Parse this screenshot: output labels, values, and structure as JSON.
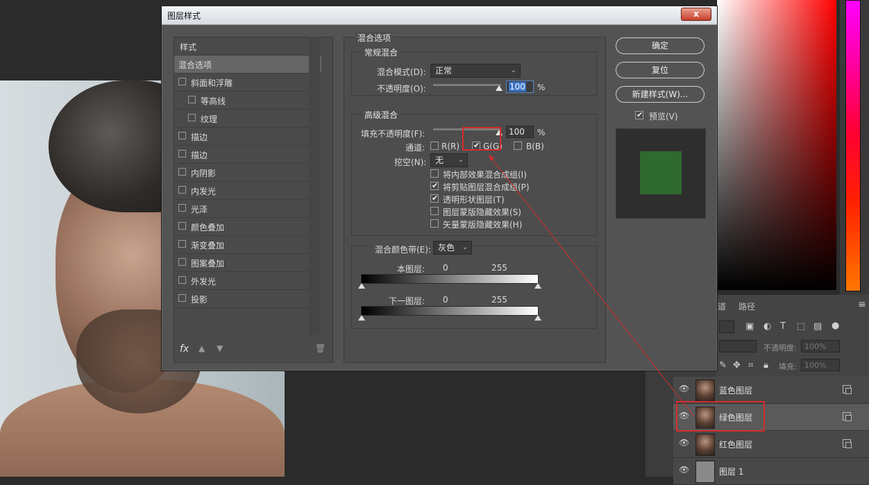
{
  "dialog": {
    "title": "图层样式",
    "close_label": "x",
    "styles_list": {
      "header": "样式",
      "items": [
        {
          "label": "混合选项",
          "checkbox": false,
          "active": true,
          "plus": false,
          "indent": false
        },
        {
          "label": "斜面和浮雕",
          "checkbox": true,
          "active": false,
          "plus": false,
          "indent": false
        },
        {
          "label": "等高线",
          "checkbox": true,
          "active": false,
          "plus": false,
          "indent": true
        },
        {
          "label": "纹理",
          "checkbox": true,
          "active": false,
          "plus": false,
          "indent": true
        },
        {
          "label": "描边",
          "checkbox": true,
          "active": false,
          "plus": true,
          "indent": false
        },
        {
          "label": "描边",
          "checkbox": true,
          "active": false,
          "plus": true,
          "indent": false
        },
        {
          "label": "内阴影",
          "checkbox": true,
          "active": false,
          "plus": true,
          "indent": false
        },
        {
          "label": "内发光",
          "checkbox": true,
          "active": false,
          "plus": false,
          "indent": false
        },
        {
          "label": "光泽",
          "checkbox": true,
          "active": false,
          "plus": false,
          "indent": false
        },
        {
          "label": "颜色叠加",
          "checkbox": true,
          "active": false,
          "plus": true,
          "indent": false
        },
        {
          "label": "渐变叠加",
          "checkbox": true,
          "active": false,
          "plus": true,
          "indent": false
        },
        {
          "label": "图案叠加",
          "checkbox": true,
          "active": false,
          "plus": false,
          "indent": false
        },
        {
          "label": "外发光",
          "checkbox": true,
          "active": false,
          "plus": false,
          "indent": false
        },
        {
          "label": "投影",
          "checkbox": true,
          "active": false,
          "plus": true,
          "indent": false
        }
      ],
      "fx_label": "fx",
      "plus_symbol": "+"
    },
    "blend": {
      "section_title": "混合选项",
      "general_title": "常规混合",
      "blend_mode_label": "混合模式(D):",
      "blend_mode_value": "正常",
      "opacity_label": "不透明度(O):",
      "opacity_value": "100",
      "percent": "%",
      "advanced_title": "高级混合",
      "fill_opacity_label": "填充不透明度(F):",
      "fill_opacity_value": "100",
      "channels_label": "通道:",
      "channel_r": "R(R)",
      "channel_g": "G(G)",
      "channel_b": "B(B)",
      "channel_r_checked": false,
      "channel_g_checked": true,
      "channel_b_checked": false,
      "knockout_label": "挖空(N):",
      "knockout_value": "无",
      "options": [
        {
          "label": "将内部效果混合成组(I)",
          "checked": false
        },
        {
          "label": "将剪贴图层混合成组(P)",
          "checked": true
        },
        {
          "label": "透明形状图层(T)",
          "checked": true
        },
        {
          "label": "图层蒙版隐藏效果(S)",
          "checked": false
        },
        {
          "label": "矢量蒙版隐藏效果(H)",
          "checked": false
        }
      ],
      "blend_if_label": "混合颜色带(E):",
      "blend_if_value": "灰色",
      "this_layer_label": "本图层:",
      "this_layer_min": "0",
      "this_layer_max": "255",
      "under_layer_label": "下一图层:",
      "under_layer_min": "0",
      "under_layer_max": "255"
    },
    "buttons": {
      "ok": "确定",
      "reset": "复位",
      "new_style": "新建样式(W)...",
      "preview_label": "预览(V)",
      "preview_checked": true
    },
    "colors": {
      "preview_swatch": "#2f6a30",
      "highlight": "#d52b2b"
    }
  },
  "layers_panel": {
    "tabs": [
      "道",
      "路径"
    ],
    "opacity_label": "不透明度:",
    "opacity_value": "100%",
    "fill_label": "填充:",
    "fill_value": "100%",
    "layers": [
      {
        "name": "蓝色图层",
        "selected": false
      },
      {
        "name": "绿色图层",
        "selected": true
      },
      {
        "name": "红色图层",
        "selected": false
      },
      {
        "name": "图层 1",
        "selected": false
      }
    ]
  }
}
